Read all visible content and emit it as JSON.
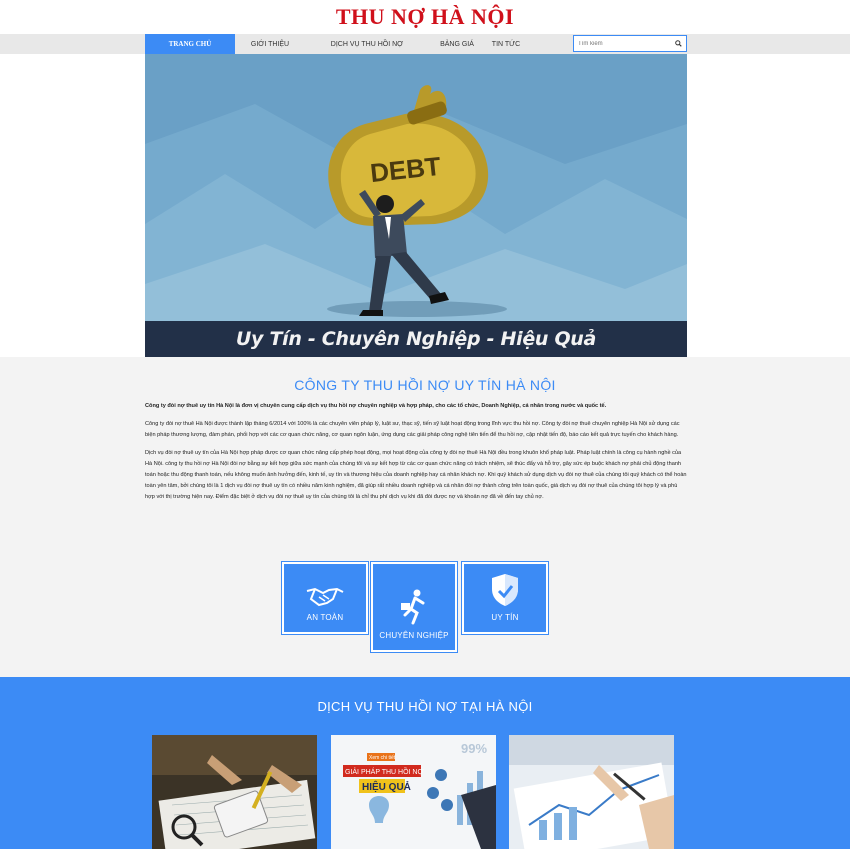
{
  "site": {
    "logo": "THU NỢ HÀ NỘI"
  },
  "nav": {
    "items": [
      "TRANG CHỦ",
      "GIỚI THIỆU",
      "DỊCH VỤ THU HỒI NỢ",
      "BẢNG GIÁ",
      "TIN TỨC"
    ],
    "search_placeholder": "Tìm kiếm"
  },
  "banner": {
    "bag_text": "DEBT",
    "caption": "Uy Tín - Chuyên Nghiệp - Hiệu Quả"
  },
  "about": {
    "title": "CÔNG TY THU HỒI NỢ UY TÍN HÀ NỘI",
    "p1": "Công ty đòi nợ thuê uy tín Hà Nội là đơn vị chuyên cung cấp dịch vụ thu hồi nợ chuyên nghiệp và hợp pháp, cho các tổ chức, Doanh Nghiệp, cá nhân trong nước và quốc tế.",
    "p2": "Công ty đòi nợ thuê Hà Nội được thành lập tháng 6/2014 với 100% là các chuyên viên pháp lý, luật sư, thạc sỹ, tiến sỹ luật hoạt động trong lĩnh vực thu hồi nợ. Công ty đòi nợ thuê chuyên nghiệp Hà Nội sử dụng các biện pháp thương lượng, đàm phán, phối hợp với các cơ quan chức năng, cơ quan ngôn luận, ứng dụng các giải pháp công nghệ tiên tiến để thu hồi nợ, cập nhật tiến độ, báo cáo kết quả trực tuyến cho khách hàng.",
    "p3": "Dịch vụ đòi nợ thuê uy tín của Hà Nội hợp pháp được cơ quan chức năng cấp phép hoạt động, mọi hoạt động của công ty đòi nợ thuê Hà Nội đều trong khuôn khổ pháp luật. Pháp luật chính là công cụ hành nghề của Hà Nội. công ty thu hồi nợ Hà Nội đòi nợ bằng sự kết hợp giữa sức mạnh của chúng tôi và sự kết hợp từ các cơ quan chức năng có trách nhiệm, sẽ thúc đẩy và hỗ trợ, gây sức ép buộc khách nợ phải chủ động thanh toán hoặc thu động thanh toán, nếu không muốn ảnh hưởng đến, kinh tế, uy tín và thương hiệu của doanh nghiệp hay cá nhân khách nợ. Khi quý khách sử dụng dịch vụ đòi nợ thuê của chúng tôi quý khách có thể hoàn toàn yên tâm, bởi chúng tôi là 1 dịch vụ đòi nợ thuê uy tín có nhiều năm kinh nghiệm, đã giúp rất nhiều doanh nghiệp và cá nhân đòi nợ thành công trên toàn quốc, giá dịch vụ đòi nợ thuê của chúng tôi hợp lý và phù hợp với thị trường hiện nay. Điểm đặc biệt ở dịch vụ đòi nợ thuê uy tín của chúng tôi là chỉ thu phí dịch vụ khi đã đòi được nợ và khoản nợ đã về đến tay chủ nợ."
  },
  "features": [
    {
      "label": "AN TOÀN",
      "icon": "handshake-icon"
    },
    {
      "label": "CHUYÊN NGHIỆP",
      "icon": "running-man-icon"
    },
    {
      "label": "UY TÍN",
      "icon": "shield-check-icon"
    }
  ],
  "services": {
    "title": "DỊCH VỤ THU HỒI NỢ TẠI HÀ NỘI",
    "promo_small": "Xem chi tiết",
    "promo_line1": "GIẢI PHÁP THU HỒI NỢ",
    "promo_line2": "HIỆU QUẢ",
    "promo_percent": "99%"
  },
  "colors": {
    "accent": "#3c8bf5",
    "logo": "#d0101b",
    "banner_sky": "#6aa0c6",
    "caption_bg": "#223048"
  }
}
